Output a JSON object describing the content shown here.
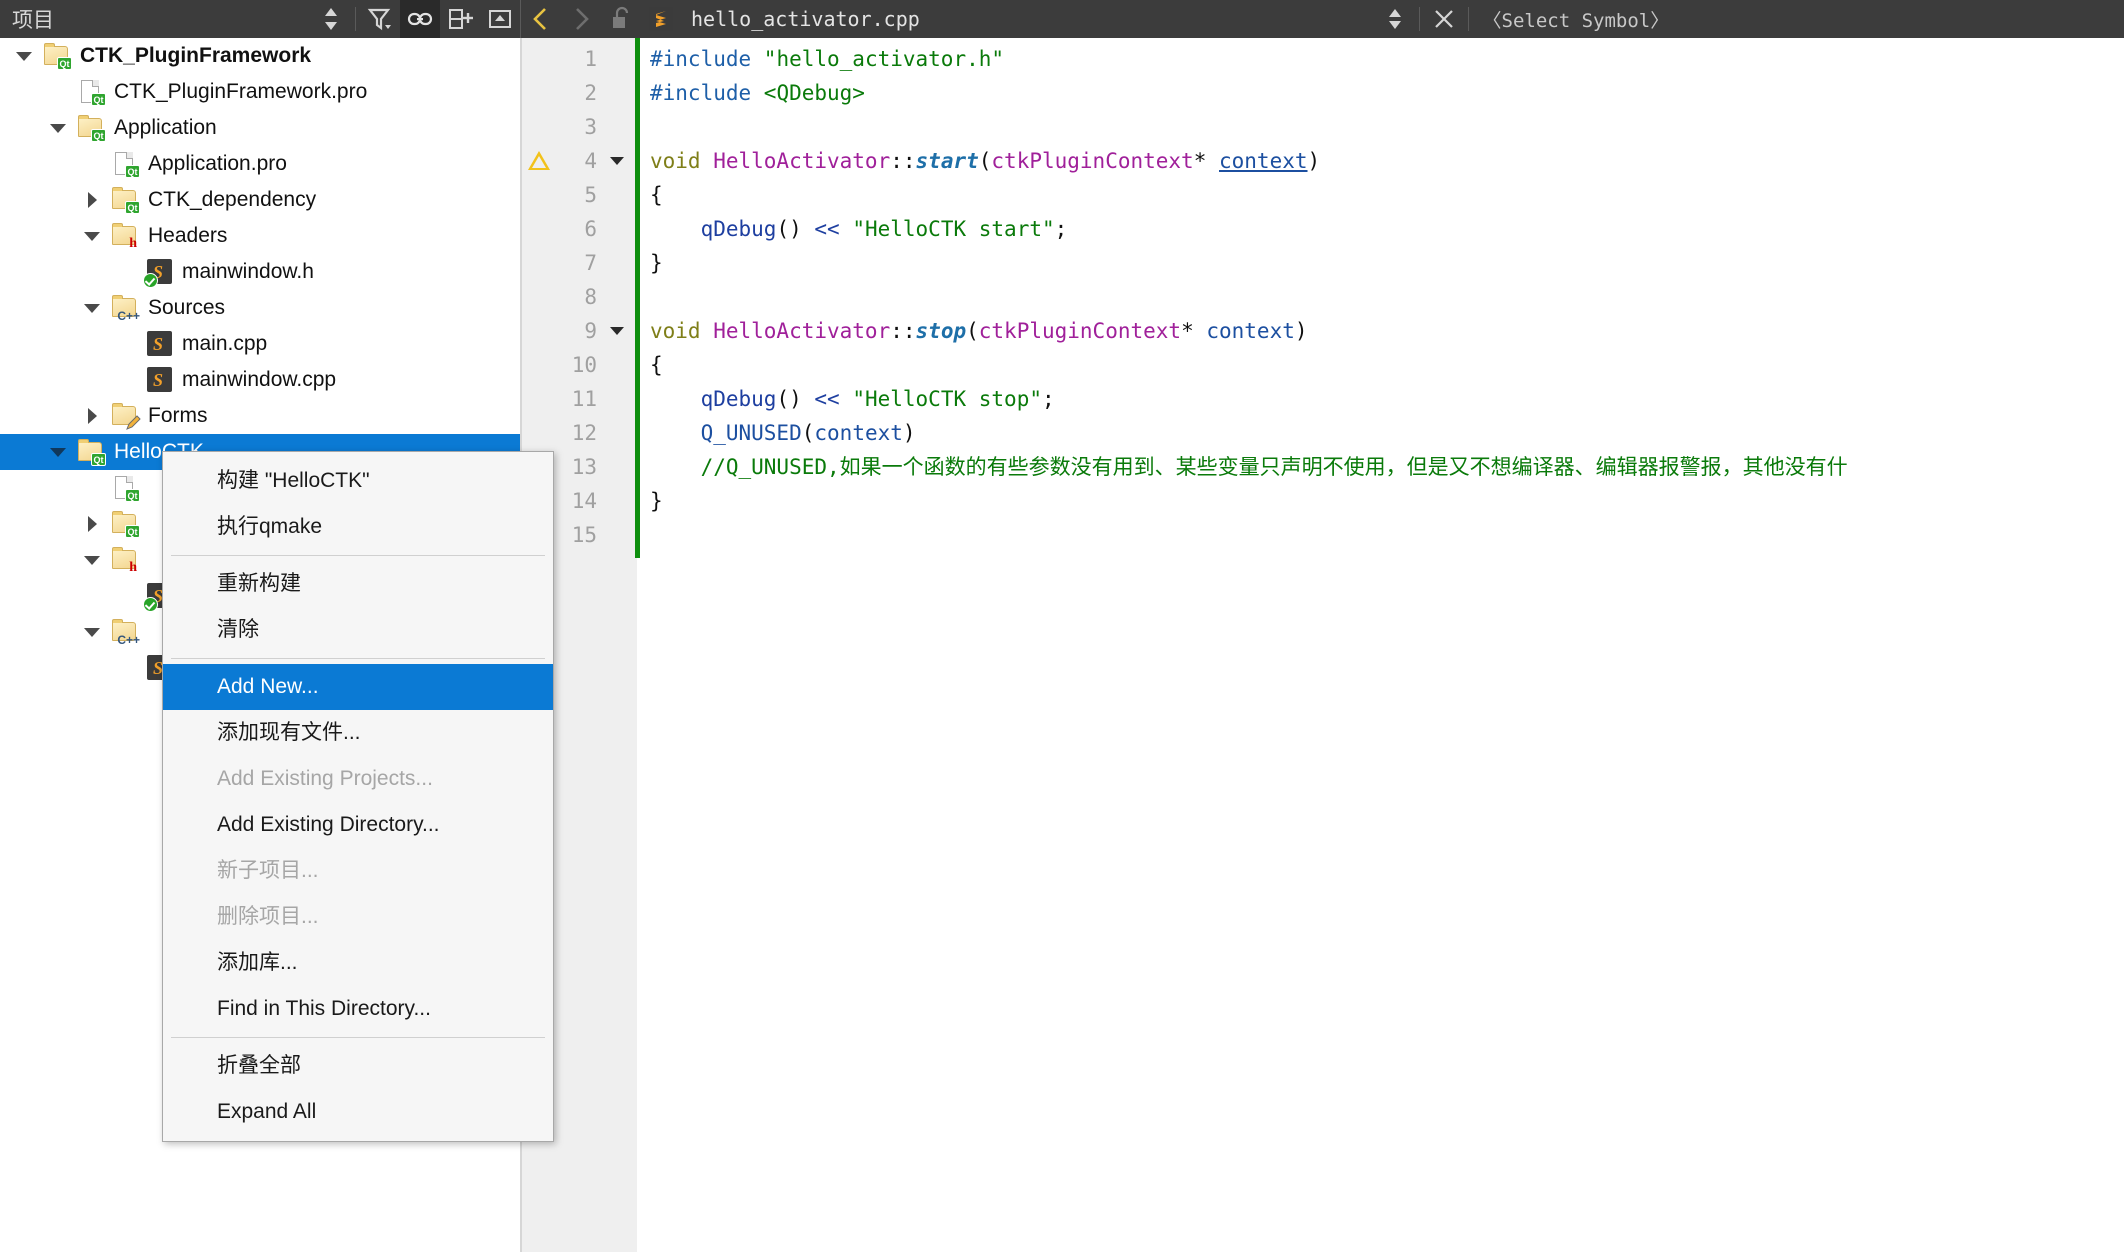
{
  "toolbar": {
    "panel_title": "项目",
    "sort_icon": "sort-updown-icon",
    "filter_icon": "filter-icon",
    "link_icon": "link-with-editor-icon",
    "split_icon": "add-split-icon",
    "close_panel_icon": "close-panel-icon",
    "back_icon": "go-back-icon",
    "forward_icon": "go-forward-icon",
    "lock_icon": "unlocked-icon",
    "file_type_icon": "sublime-file-icon",
    "filename": "hello_activator.cpp",
    "file_dropdown_icon": "updown-chevrons-icon",
    "close_document_icon": "close-x-icon",
    "symbol_selector": "〈Select Symbol〉"
  },
  "sidebar": {
    "tree": [
      {
        "label": "CTK_PluginFramework",
        "depth": 0,
        "arrow": "down",
        "icon": "folder-qt-icon",
        "bold": true,
        "selected": false
      },
      {
        "label": "CTK_PluginFramework.pro",
        "depth": 1,
        "arrow": "none",
        "icon": "page-qt-icon",
        "bold": false,
        "selected": false
      },
      {
        "label": "Application",
        "depth": 1,
        "arrow": "down",
        "icon": "folder-qt-icon",
        "bold": false,
        "selected": false
      },
      {
        "label": "Application.pro",
        "depth": 2,
        "arrow": "none",
        "icon": "page-qt-icon",
        "bold": false,
        "selected": false
      },
      {
        "label": "CTK_dependency",
        "depth": 2,
        "arrow": "right",
        "icon": "folder-qt-icon",
        "bold": false,
        "selected": false
      },
      {
        "label": "Headers",
        "depth": 2,
        "arrow": "down",
        "icon": "folder-h-icon",
        "bold": false,
        "selected": false
      },
      {
        "label": "mainwindow.h",
        "depth": 3,
        "arrow": "none",
        "icon": "file-check-icon",
        "bold": false,
        "selected": false
      },
      {
        "label": "Sources",
        "depth": 2,
        "arrow": "down",
        "icon": "folder-cpp-icon",
        "bold": false,
        "selected": false
      },
      {
        "label": "main.cpp",
        "depth": 3,
        "arrow": "none",
        "icon": "sublime-file-icon",
        "bold": false,
        "selected": false
      },
      {
        "label": "mainwindow.cpp",
        "depth": 3,
        "arrow": "none",
        "icon": "sublime-file-icon",
        "bold": false,
        "selected": false
      },
      {
        "label": "Forms",
        "depth": 2,
        "arrow": "right",
        "icon": "folder-form-icon",
        "bold": false,
        "selected": false
      },
      {
        "label": "HelloCTK",
        "depth": 1,
        "arrow": "down",
        "icon": "folder-qt-icon",
        "bold": false,
        "selected": true
      },
      {
        "label": "",
        "depth": 2,
        "arrow": "none",
        "icon": "page-qt-icon",
        "bold": false,
        "selected": false
      },
      {
        "label": "",
        "depth": 2,
        "arrow": "right",
        "icon": "folder-qt-icon",
        "bold": false,
        "selected": false
      },
      {
        "label": "",
        "depth": 2,
        "arrow": "down",
        "icon": "folder-h-icon",
        "bold": false,
        "selected": false
      },
      {
        "label": "",
        "depth": 3,
        "arrow": "none",
        "icon": "file-check-icon",
        "bold": false,
        "selected": false
      },
      {
        "label": "",
        "depth": 2,
        "arrow": "down",
        "icon": "folder-cpp-icon",
        "bold": false,
        "selected": false
      },
      {
        "label": "",
        "depth": 3,
        "arrow": "none",
        "icon": "sublime-file-icon",
        "bold": false,
        "selected": false
      }
    ]
  },
  "context_menu": {
    "items": [
      {
        "label": "构建 \"HelloCTK\"",
        "state": "normal"
      },
      {
        "label": "执行qmake",
        "state": "normal"
      },
      {
        "label": "",
        "state": "separator"
      },
      {
        "label": "重新构建",
        "state": "normal"
      },
      {
        "label": "清除",
        "state": "normal"
      },
      {
        "label": "",
        "state": "separator"
      },
      {
        "label": "Add New...",
        "state": "highlight"
      },
      {
        "label": "添加现有文件...",
        "state": "normal"
      },
      {
        "label": "Add Existing Projects...",
        "state": "disabled"
      },
      {
        "label": "Add Existing Directory...",
        "state": "normal"
      },
      {
        "label": "新子项目...",
        "state": "disabled"
      },
      {
        "label": "删除项目...",
        "state": "disabled"
      },
      {
        "label": "添加库...",
        "state": "normal"
      },
      {
        "label": "Find in This Directory...",
        "state": "normal"
      },
      {
        "label": "",
        "state": "separator"
      },
      {
        "label": "折叠全部",
        "state": "normal"
      },
      {
        "label": "Expand All",
        "state": "normal"
      }
    ]
  },
  "editor": {
    "line_numbers": [
      "1",
      "2",
      "3",
      "4",
      "5",
      "6",
      "7",
      "8",
      "9",
      "10",
      "11",
      "12",
      "13",
      "14",
      "15"
    ],
    "warning_on_line": 4,
    "fold_markers_on_lines": [
      4,
      9
    ],
    "code_lines": [
      {
        "n": 1,
        "tokens": [
          {
            "t": "#include ",
            "c": "tk-pre"
          },
          {
            "t": "\"hello_activator.h\"",
            "c": "tk-str"
          }
        ]
      },
      {
        "n": 2,
        "tokens": [
          {
            "t": "#include ",
            "c": "tk-pre"
          },
          {
            "t": "<QDebug>",
            "c": "tk-str"
          }
        ]
      },
      {
        "n": 3,
        "tokens": []
      },
      {
        "n": 4,
        "tokens": [
          {
            "t": "void ",
            "c": "tk-kw"
          },
          {
            "t": "HelloActivator",
            "c": "tk-type"
          },
          {
            "t": "::",
            "c": "tk-plain"
          },
          {
            "t": "start",
            "c": "tk-fn"
          },
          {
            "t": "(",
            "c": "tk-plain"
          },
          {
            "t": "ctkPluginContext",
            "c": "tk-type"
          },
          {
            "t": "* ",
            "c": "tk-plain"
          },
          {
            "t": "context",
            "c": "tk-var tk-ul"
          },
          {
            "t": ")",
            "c": "tk-plain"
          }
        ]
      },
      {
        "n": 5,
        "tokens": [
          {
            "t": "{",
            "c": "tk-plain"
          }
        ]
      },
      {
        "n": 6,
        "tokens": [
          {
            "t": "    ",
            "c": "tk-plain"
          },
          {
            "t": "qDebug",
            "c": "tk-call"
          },
          {
            "t": "() ",
            "c": "tk-plain"
          },
          {
            "t": "<<",
            "c": "tk-call"
          },
          {
            "t": " ",
            "c": "tk-plain"
          },
          {
            "t": "\"HelloCTK start\"",
            "c": "tk-str"
          },
          {
            "t": ";",
            "c": "tk-plain"
          }
        ]
      },
      {
        "n": 7,
        "tokens": [
          {
            "t": "}",
            "c": "tk-plain"
          }
        ]
      },
      {
        "n": 8,
        "tokens": []
      },
      {
        "n": 9,
        "tokens": [
          {
            "t": "void ",
            "c": "tk-kw"
          },
          {
            "t": "HelloActivator",
            "c": "tk-type"
          },
          {
            "t": "::",
            "c": "tk-plain"
          },
          {
            "t": "stop",
            "c": "tk-fn"
          },
          {
            "t": "(",
            "c": "tk-plain"
          },
          {
            "t": "ctkPluginContext",
            "c": "tk-type"
          },
          {
            "t": "* ",
            "c": "tk-plain"
          },
          {
            "t": "context",
            "c": "tk-var"
          },
          {
            "t": ")",
            "c": "tk-plain"
          }
        ]
      },
      {
        "n": 10,
        "tokens": [
          {
            "t": "{",
            "c": "tk-plain"
          }
        ]
      },
      {
        "n": 11,
        "tokens": [
          {
            "t": "    ",
            "c": "tk-plain"
          },
          {
            "t": "qDebug",
            "c": "tk-call"
          },
          {
            "t": "() ",
            "c": "tk-plain"
          },
          {
            "t": "<<",
            "c": "tk-call"
          },
          {
            "t": " ",
            "c": "tk-plain"
          },
          {
            "t": "\"HelloCTK stop\"",
            "c": "tk-str"
          },
          {
            "t": ";",
            "c": "tk-plain"
          }
        ]
      },
      {
        "n": 12,
        "tokens": [
          {
            "t": "    ",
            "c": "tk-plain"
          },
          {
            "t": "Q_UNUSED",
            "c": "tk-macro"
          },
          {
            "t": "(",
            "c": "tk-plain"
          },
          {
            "t": "context",
            "c": "tk-var"
          },
          {
            "t": ")",
            "c": "tk-plain"
          }
        ]
      },
      {
        "n": 13,
        "tokens": [
          {
            "t": "    ",
            "c": "tk-plain"
          },
          {
            "t": "//Q_UNUSED,如果一个函数的有些参数没有用到、某些变量只声明不使用，但是又不想编译器、编辑器报警报，其他没有什",
            "c": "tk-cmt"
          }
        ]
      },
      {
        "n": 14,
        "tokens": [
          {
            "t": "}",
            "c": "tk-plain"
          }
        ]
      },
      {
        "n": 15,
        "tokens": []
      }
    ]
  },
  "colors": {
    "toolbar_bg": "#3c3c3c",
    "selection_blue": "#0b7ad4",
    "gutter_bg": "#efefef",
    "modified_marker_green": "#0e8f0e",
    "warning_yellow": "#f2c21b"
  }
}
